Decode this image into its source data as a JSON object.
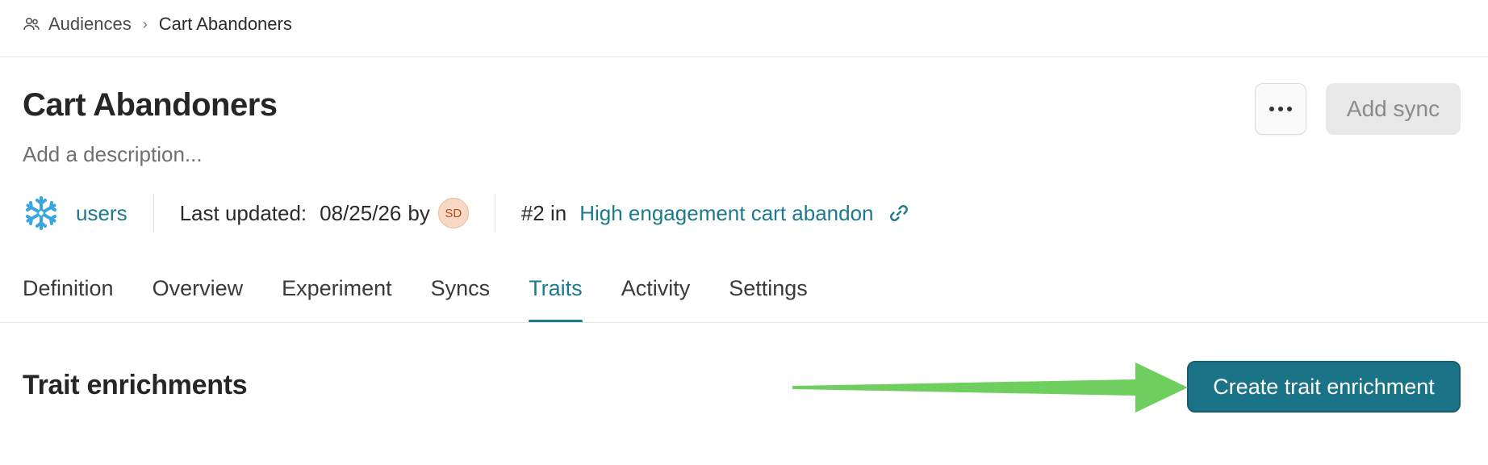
{
  "breadcrumb": {
    "icon": "users-icon",
    "parent": "Audiences",
    "separator": "›",
    "current": "Cart Abandoners"
  },
  "header": {
    "title": "Cart Abandoners",
    "description_placeholder": "Add a description...",
    "more_icon": "more-horizontal-icon",
    "add_sync_label": "Add sync"
  },
  "meta": {
    "source_icon": "snowflake-icon",
    "source_name": "users",
    "last_updated_label": "Last updated:",
    "last_updated_value": "08/25/26",
    "by_label": "by",
    "avatar_initials": "SD",
    "rank_label": "#2 in",
    "parent_audience": "High engagement cart abandon",
    "link_icon": "link-icon"
  },
  "tabs": [
    {
      "label": "Definition",
      "active": false
    },
    {
      "label": "Overview",
      "active": false
    },
    {
      "label": "Experiment",
      "active": false
    },
    {
      "label": "Syncs",
      "active": false
    },
    {
      "label": "Traits",
      "active": true
    },
    {
      "label": "Activity",
      "active": false
    },
    {
      "label": "Settings",
      "active": false
    }
  ],
  "section": {
    "title": "Trait enrichments",
    "create_button_label": "Create trait enrichment"
  },
  "colors": {
    "accent": "#1d7a8c",
    "primary_button": "#1b7388",
    "annotation_arrow": "#6fcf5e"
  }
}
